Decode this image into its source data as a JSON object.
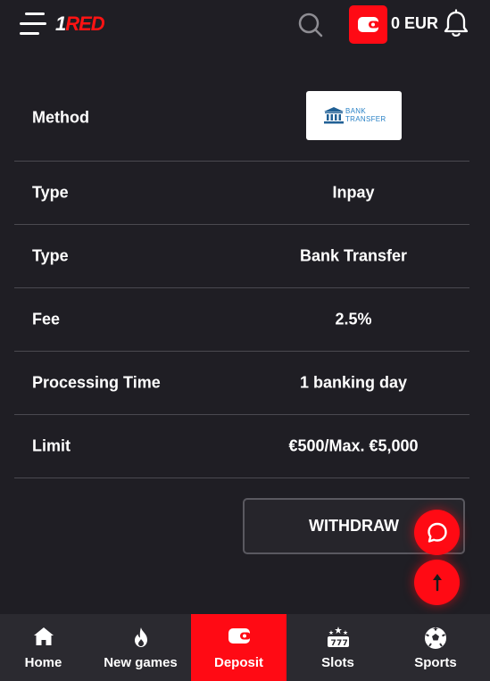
{
  "header": {
    "logo_num": "1",
    "logo_red": "RED",
    "balance": "0 EUR"
  },
  "details": {
    "method_label": "Method",
    "method_logo_text_1": "BANK",
    "method_logo_text_2": "TRANSFER",
    "rows": [
      {
        "label": "Type",
        "value": "Inpay"
      },
      {
        "label": "Type",
        "value": "Bank Transfer"
      },
      {
        "label": "Fee",
        "value": "2.5%"
      },
      {
        "label": "Processing Time",
        "value": "1 banking day"
      },
      {
        "label": "Limit",
        "value": "€500/Max. €5,000"
      }
    ]
  },
  "withdraw_label": "WITHDRAW",
  "bottom_nav": [
    {
      "label": "Home",
      "icon": "home-icon"
    },
    {
      "label": "New games",
      "icon": "flame-icon"
    },
    {
      "label": "Deposit",
      "icon": "wallet-icon",
      "active": true
    },
    {
      "label": "Slots",
      "icon": "slot-machine-icon"
    },
    {
      "label": "Sports",
      "icon": "soccer-ball-icon"
    }
  ],
  "colors": {
    "accent": "#ff0a14",
    "background": "#1f1e24",
    "nav_background": "#2b2a30",
    "divider": "#4a4950",
    "bank_logo_blue": "#2a82c6"
  }
}
